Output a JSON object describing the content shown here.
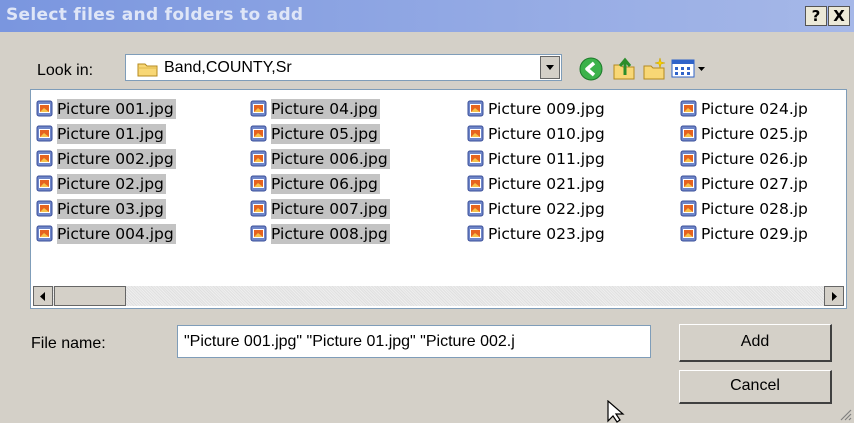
{
  "dialog": {
    "title": "Select files and folders to add",
    "help_btn": "?",
    "close_btn": "X"
  },
  "lookin": {
    "label": "Look in:",
    "value": "Band,COUNTY,Sr"
  },
  "toolbar": {
    "icons": [
      "back-icon",
      "up-folder-icon",
      "new-folder-icon",
      "view-menu-icon"
    ]
  },
  "files": [
    {
      "name": "Picture 001.jpg",
      "selected": true
    },
    {
      "name": "Picture 01.jpg",
      "selected": true
    },
    {
      "name": "Picture 002.jpg",
      "selected": true
    },
    {
      "name": "Picture 02.jpg",
      "selected": true
    },
    {
      "name": "Picture 03.jpg",
      "selected": true
    },
    {
      "name": "Picture 004.jpg",
      "selected": true
    },
    {
      "name": "Picture 04.jpg",
      "selected": true
    },
    {
      "name": "Picture 05.jpg",
      "selected": true
    },
    {
      "name": "Picture 006.jpg",
      "selected": true
    },
    {
      "name": "Picture 06.jpg",
      "selected": true
    },
    {
      "name": "Picture 007.jpg",
      "selected": true
    },
    {
      "name": "Picture 008.jpg",
      "selected": true
    },
    {
      "name": "Picture 009.jpg",
      "selected": false
    },
    {
      "name": "Picture 010.jpg",
      "selected": false
    },
    {
      "name": "Picture 011.jpg",
      "selected": false
    },
    {
      "name": "Picture 021.jpg",
      "selected": false
    },
    {
      "name": "Picture 022.jpg",
      "selected": false
    },
    {
      "name": "Picture 023.jpg",
      "selected": false
    },
    {
      "name": "Picture 024.jp",
      "selected": false
    },
    {
      "name": "Picture 025.jp",
      "selected": false
    },
    {
      "name": "Picture 026.jp",
      "selected": false
    },
    {
      "name": "Picture 027.jp",
      "selected": false
    },
    {
      "name": "Picture 028.jp",
      "selected": false
    },
    {
      "name": "Picture 029.jp",
      "selected": false
    }
  ],
  "filename": {
    "label": "File name:",
    "value": "\"Picture 001.jpg\" \"Picture 01.jpg\" \"Picture 002.j"
  },
  "buttons": {
    "add": "Add",
    "cancel": "Cancel"
  }
}
